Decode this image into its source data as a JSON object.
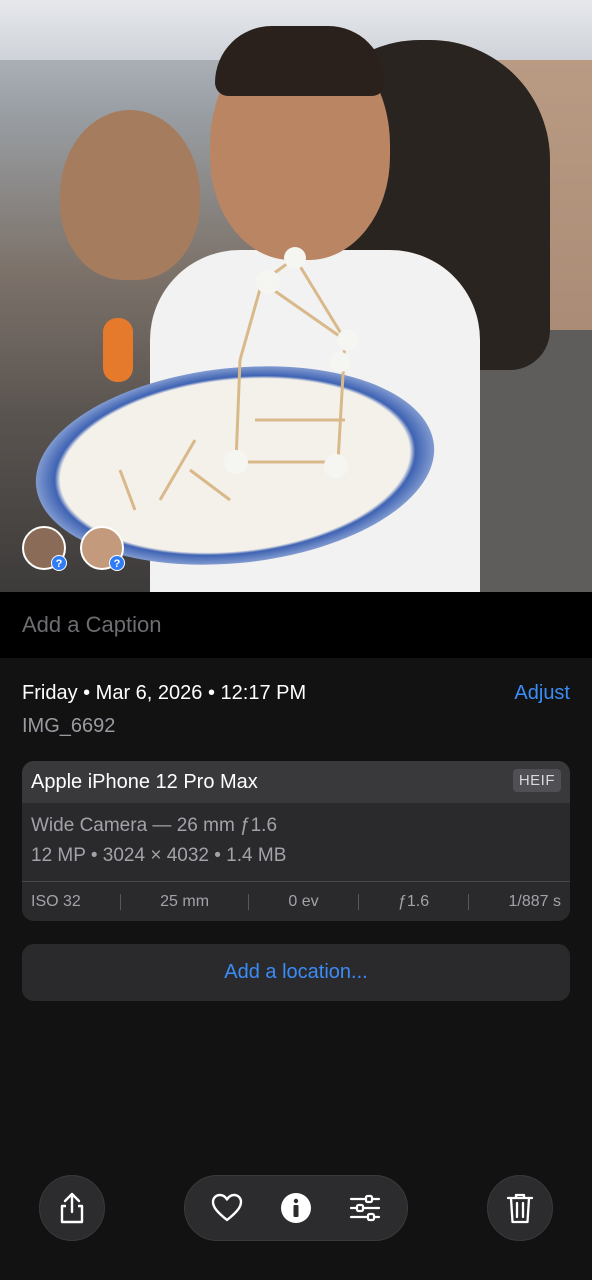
{
  "photo": {
    "faces": [
      {
        "badge": "?"
      },
      {
        "badge": "?"
      }
    ]
  },
  "caption": {
    "placeholder": "Add a Caption"
  },
  "info": {
    "date": "Friday • Mar 6, 2026 • 12:17 PM",
    "adjust_label": "Adjust",
    "filename": "IMG_6692"
  },
  "camera": {
    "model": "Apple iPhone 12 Pro Max",
    "format": "HEIF",
    "lens": "Wide Camera — 26 mm ƒ1.6",
    "details": "12 MP • 3024 × 4032 • 1.4 MB",
    "exif": {
      "iso": "ISO 32",
      "focal": "25 mm",
      "ev": "0 ev",
      "aperture": "ƒ1.6",
      "shutter": "1/887 s"
    }
  },
  "location": {
    "label": "Add a location..."
  },
  "toolbar": {
    "icons": [
      "share-icon",
      "heart-icon",
      "info-icon",
      "adjust-icon",
      "trash-icon"
    ],
    "accent": "#3b8cf6"
  }
}
